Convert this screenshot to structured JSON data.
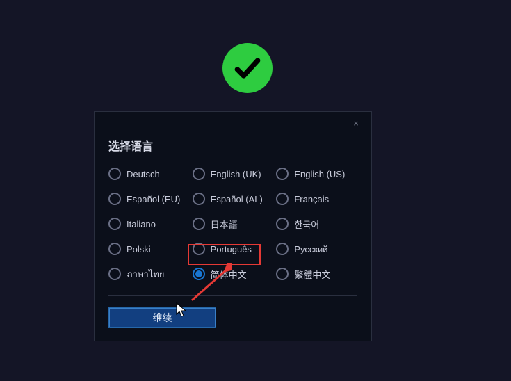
{
  "checkmark": {
    "name": "success-checkmark"
  },
  "dialog": {
    "title": "选择语言",
    "minimize_label": "–",
    "close_label": "×",
    "continue_label": "维续",
    "options": [
      {
        "label": "Deutsch",
        "selected": false
      },
      {
        "label": "English (UK)",
        "selected": false
      },
      {
        "label": "English (US)",
        "selected": false
      },
      {
        "label": "Español (EU)",
        "selected": false
      },
      {
        "label": "Español (AL)",
        "selected": false
      },
      {
        "label": "Français",
        "selected": false
      },
      {
        "label": "Italiano",
        "selected": false
      },
      {
        "label": "日本語",
        "selected": false
      },
      {
        "label": "한국어",
        "selected": false
      },
      {
        "label": "Polski",
        "selected": false
      },
      {
        "label": "Português",
        "selected": false
      },
      {
        "label": "Русский",
        "selected": false
      },
      {
        "label": "ภาษาไทย",
        "selected": false
      },
      {
        "label": "简体中文",
        "selected": true
      },
      {
        "label": "繁體中文",
        "selected": false
      }
    ]
  }
}
